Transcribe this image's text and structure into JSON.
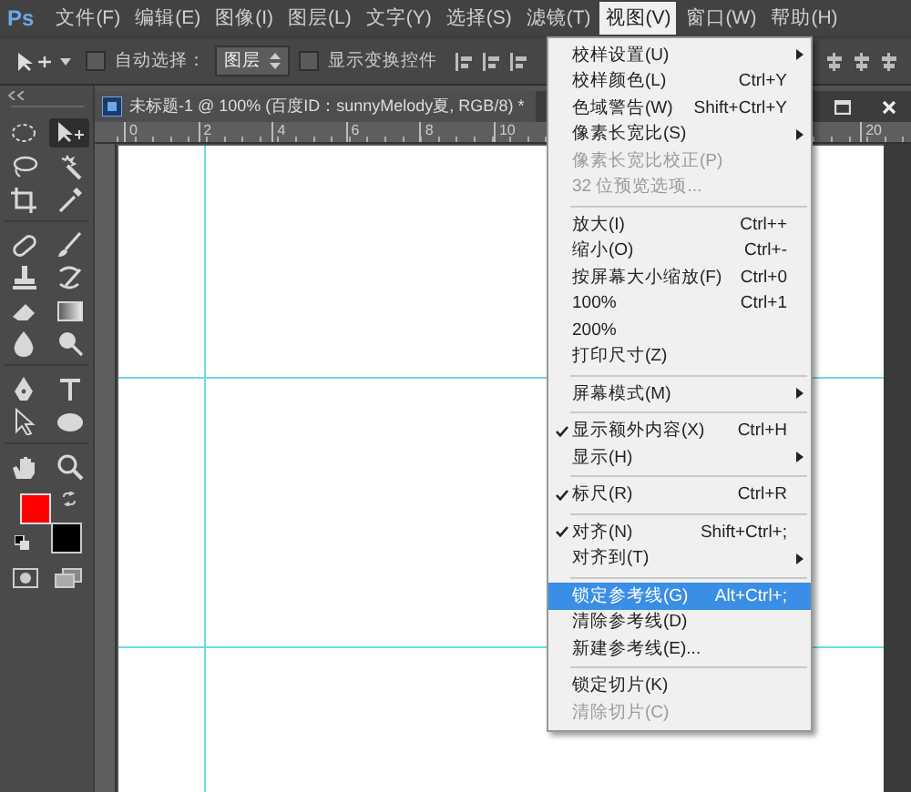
{
  "app_logo": "Ps",
  "menu_bar": [
    {
      "label": "文件(F)",
      "selected": false
    },
    {
      "label": "编辑(E)",
      "selected": false
    },
    {
      "label": "图像(I)",
      "selected": false
    },
    {
      "label": "图层(L)",
      "selected": false
    },
    {
      "label": "文字(Y)",
      "selected": false
    },
    {
      "label": "选择(S)",
      "selected": false
    },
    {
      "label": "滤镜(T)",
      "selected": false
    },
    {
      "label": "视图(V)",
      "selected": true
    },
    {
      "label": "窗口(W)",
      "selected": false
    },
    {
      "label": "帮助(H)",
      "selected": false
    }
  ],
  "options_bar": {
    "auto_select": {
      "label": "自动选择：",
      "checked": false
    },
    "layer_select": {
      "value": "图层"
    },
    "show_transform": {
      "label": "显示变换控件",
      "checked": false
    }
  },
  "tools": [
    {
      "kind": "marquee",
      "selected": false
    },
    {
      "kind": "move",
      "selected": true
    },
    {
      "kind": "lasso",
      "selected": false
    },
    {
      "kind": "wand",
      "selected": false
    },
    {
      "kind": "crop",
      "selected": false
    },
    {
      "kind": "eyedropper",
      "selected": false
    },
    {
      "kind": "separator"
    },
    {
      "kind": "healing",
      "selected": false
    },
    {
      "kind": "brush",
      "selected": false
    },
    {
      "kind": "stamp",
      "selected": false
    },
    {
      "kind": "history",
      "selected": false
    },
    {
      "kind": "eraser",
      "selected": false
    },
    {
      "kind": "gradient",
      "selected": false
    },
    {
      "kind": "blur",
      "selected": false
    },
    {
      "kind": "dodge",
      "selected": false
    },
    {
      "kind": "separator"
    },
    {
      "kind": "pen",
      "selected": false
    },
    {
      "kind": "type",
      "selected": false
    },
    {
      "kind": "pointer",
      "selected": false
    },
    {
      "kind": "ellipse",
      "selected": false
    },
    {
      "kind": "separator"
    },
    {
      "kind": "hand",
      "selected": false
    },
    {
      "kind": "zoom",
      "selected": false
    }
  ],
  "swatches": [
    {
      "color": "#ff0000"
    },
    {
      "color": "#000000"
    }
  ],
  "document": {
    "title": "未标题-1 @ 100% (百度ID：sunnyMelody夏, RGB/8) *",
    "ruler_labels": [
      "0",
      "2",
      "4",
      "6",
      "8",
      "10",
      "20"
    ]
  },
  "view_menu": [
    {
      "kind": "item",
      "label": "校样设置(U)",
      "submenu": true
    },
    {
      "kind": "item",
      "label": "校样颜色(L)",
      "shortcut": "Ctrl+Y"
    },
    {
      "kind": "item",
      "label": "色域警告(W)",
      "shortcut": "Shift+Ctrl+Y"
    },
    {
      "kind": "item",
      "label": "像素长宽比(S)",
      "submenu": true
    },
    {
      "kind": "item",
      "label": "像素长宽比校正(P)",
      "disabled": true
    },
    {
      "kind": "item",
      "label": "32 位预览选项...",
      "disabled": true
    },
    {
      "kind": "separator"
    },
    {
      "kind": "item",
      "label": "放大(I)",
      "shortcut": "Ctrl++"
    },
    {
      "kind": "item",
      "label": "缩小(O)",
      "shortcut": "Ctrl+-"
    },
    {
      "kind": "item",
      "label": "按屏幕大小缩放(F)",
      "shortcut": "Ctrl+0"
    },
    {
      "kind": "item",
      "label": "100%",
      "shortcut": "Ctrl+1"
    },
    {
      "kind": "item",
      "label": "200%"
    },
    {
      "kind": "item",
      "label": "打印尺寸(Z)"
    },
    {
      "kind": "separator"
    },
    {
      "kind": "item",
      "label": "屏幕模式(M)",
      "submenu": true
    },
    {
      "kind": "separator"
    },
    {
      "kind": "item",
      "label": "显示额外内容(X)",
      "shortcut": "Ctrl+H",
      "checked": true
    },
    {
      "kind": "item",
      "label": "显示(H)",
      "submenu": true
    },
    {
      "kind": "separator"
    },
    {
      "kind": "item",
      "label": "标尺(R)",
      "shortcut": "Ctrl+R",
      "checked": true
    },
    {
      "kind": "separator"
    },
    {
      "kind": "item",
      "label": "对齐(N)",
      "shortcut": "Shift+Ctrl+;",
      "checked": true
    },
    {
      "kind": "item",
      "label": "对齐到(T)",
      "submenu": true
    },
    {
      "kind": "separator"
    },
    {
      "kind": "item",
      "label": "锁定参考线(G)",
      "shortcut": "Alt+Ctrl+;",
      "selected": true
    },
    {
      "kind": "item",
      "label": "清除参考线(D)"
    },
    {
      "kind": "item",
      "label": "新建参考线(E)..."
    },
    {
      "kind": "separator"
    },
    {
      "kind": "item",
      "label": "锁定切片(K)"
    },
    {
      "kind": "item",
      "label": "清除切片(C)",
      "disabled": true
    }
  ]
}
